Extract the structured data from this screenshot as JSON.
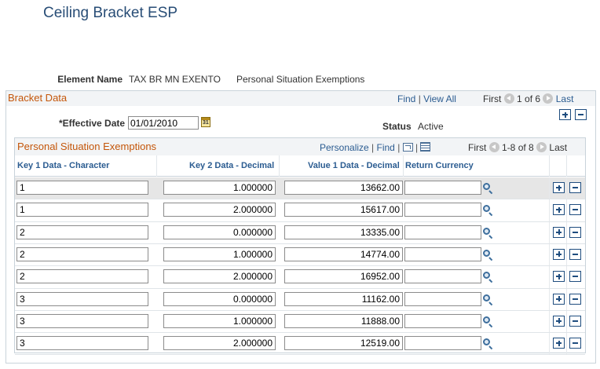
{
  "page": {
    "title": "Ceiling Bracket ESP"
  },
  "element": {
    "label": "Element Name",
    "value": "TAX BR MN EXENTO",
    "description": "Personal Situation Exemptions"
  },
  "bracket": {
    "title": "Bracket Data",
    "nav": {
      "find": "Find",
      "sep": "|",
      "view_all": "View All",
      "first": "First",
      "range": "1 of 6",
      "last": "Last"
    },
    "effective_date_label": "*Effective Date",
    "effective_date": "01/01/2010",
    "calendar_icon_text": "31",
    "status_label": "Status",
    "status_value": "Active"
  },
  "grid": {
    "title": "Personal Situation Exemptions",
    "nav": {
      "personalize": "Personalize",
      "sep": "|",
      "find": "Find",
      "sep2": "|",
      "first": "First",
      "range": "1-8 of 8",
      "last": "Last"
    },
    "columns": [
      "Key 1 Data - Character",
      "Key 2 Data - Decimal",
      "Value 1 Data - Decimal",
      "Return Currency"
    ],
    "rows": [
      {
        "key1": "1",
        "key2": "1.000000",
        "value": "13662.00",
        "currency": ""
      },
      {
        "key1": "1",
        "key2": "2.000000",
        "value": "15617.00",
        "currency": ""
      },
      {
        "key1": "2",
        "key2": "0.000000",
        "value": "13335.00",
        "currency": ""
      },
      {
        "key1": "2",
        "key2": "1.000000",
        "value": "14774.00",
        "currency": ""
      },
      {
        "key1": "2",
        "key2": "2.000000",
        "value": "16952.00",
        "currency": ""
      },
      {
        "key1": "3",
        "key2": "0.000000",
        "value": "11162.00",
        "currency": ""
      },
      {
        "key1": "3",
        "key2": "1.000000",
        "value": "11888.00",
        "currency": ""
      },
      {
        "key1": "3",
        "key2": "2.000000",
        "value": "12519.00",
        "currency": ""
      }
    ]
  },
  "icons": {
    "prev": "chevron-left-icon",
    "next": "chevron-right-icon",
    "add": "plus-icon",
    "delete": "minus-icon",
    "lookup": "search-icon",
    "calendar": "calendar-icon",
    "zoom": "zoom-grid-icon",
    "download": "download-grid-icon"
  },
  "colors": {
    "title": "#284d76",
    "section_title": "#c4560a",
    "link": "#2b5c91",
    "selected_row": "#e6e6e6"
  }
}
